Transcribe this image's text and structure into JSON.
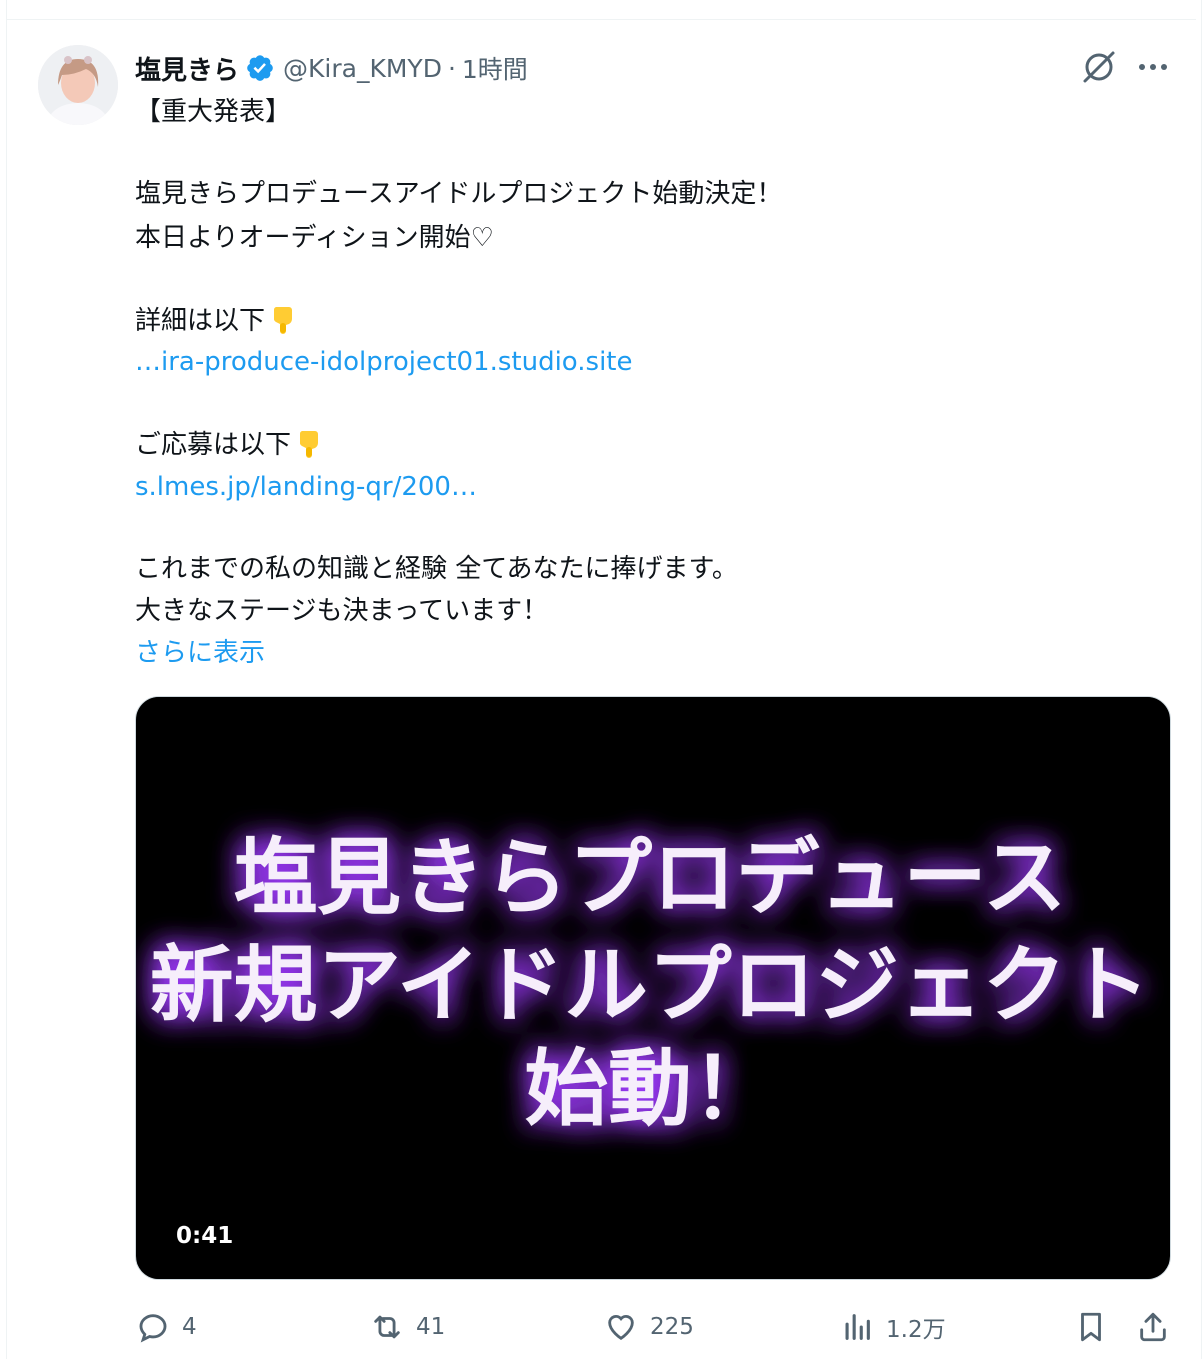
{
  "author": {
    "name": "塩見きら",
    "handle": "@Kira_KMYD",
    "separator": "·",
    "time": "1時間"
  },
  "post": {
    "line1": "【重大発表】",
    "line2": "塩見きらプロデュースアイドルプロジェクト始動決定！",
    "line3": "本日よりオーディション開始♡",
    "line4": "詳細は以下",
    "link1": "…ira-produce-idolproject01.studio.site",
    "line5": "ご応募は以下",
    "link2": "s.lmes.jp/landing-qr/200…",
    "line6": "これまでの私の知識と経験 全てあなたに捧げます。",
    "line7": "大きなステージも決まっています！",
    "show_more": "さらに表示"
  },
  "video": {
    "title_line1": "塩見きらプロデュース",
    "title_line2": "新規アイドルプロジェクト",
    "title_line3": "始動！",
    "duration": "0:41"
  },
  "actions": {
    "replies": "4",
    "reposts": "41",
    "likes": "225",
    "views": "1.2万"
  },
  "colors": {
    "accent": "#1d9bf0",
    "secondary_text": "#536471",
    "glow": "#a03cff"
  }
}
